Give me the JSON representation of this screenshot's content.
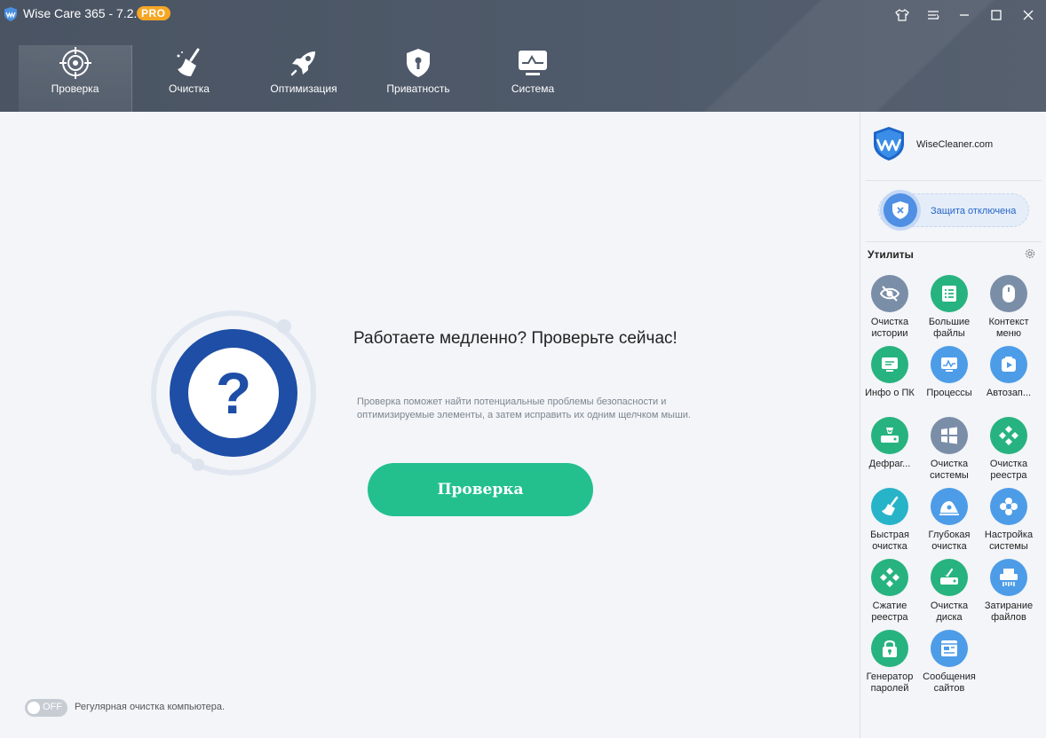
{
  "app": {
    "title": "Wise Care 365 - 7.2.5",
    "badge": "PRO"
  },
  "nav": [
    {
      "label": "Проверка",
      "icon": "crosshair-icon",
      "active": true
    },
    {
      "label": "Очистка",
      "icon": "broom-icon"
    },
    {
      "label": "Оптимизация",
      "icon": "rocket-icon"
    },
    {
      "label": "Приватность",
      "icon": "shield-lock-icon"
    },
    {
      "label": "Система",
      "icon": "monitor-icon"
    }
  ],
  "main": {
    "headline": "Работаете медленно? Проверьте сейчас!",
    "description": "Проверка поможет найти потенциальные проблемы безопасности и оптимизируемые элементы, а затем исправить их одним щелчком мыши.",
    "scan_button": "Проверка",
    "toggle_state": "OFF",
    "toggle_label": "Регулярная очистка компьютера."
  },
  "sidebar": {
    "brand": "WiseCleaner.com",
    "protection": "Защита отключена",
    "tools_title": "Утилиты",
    "tools": [
      {
        "label": "Очистка\nистории",
        "icon": "eye-off-icon",
        "color": "#7b8ea8"
      },
      {
        "label": "Большие\nфайлы",
        "icon": "file-list-icon",
        "color": "#27b37f"
      },
      {
        "label": "Контекст\nменю",
        "icon": "mouse-icon",
        "color": "#7b8ea8"
      },
      {
        "label": "Инфо о ПК",
        "icon": "pc-info-icon",
        "color": "#27b37f"
      },
      {
        "label": "Процессы",
        "icon": "process-monitor-icon",
        "color": "#4d9ce8"
      },
      {
        "label": "Автозап...",
        "icon": "play-icon",
        "color": "#4d9ce8"
      },
      {
        "label": "Дефраг...",
        "icon": "disk-defrag-icon",
        "color": "#27b37f"
      },
      {
        "label": "Очистка\nсистемы",
        "icon": "windows-icon",
        "color": "#7b8ea8"
      },
      {
        "label": "Очистка\nреестра",
        "icon": "registry-icon",
        "color": "#27b37f"
      },
      {
        "label": "Быстрая\nочистка",
        "icon": "broom-icon",
        "color": "#27b3c8"
      },
      {
        "label": "Глубокая\nочистка",
        "icon": "vacuum-icon",
        "color": "#4d9ce8"
      },
      {
        "label": "Настройка\nсистемы",
        "icon": "settings-flower-icon",
        "color": "#4d9ce8"
      },
      {
        "label": "Сжатие\nреестра",
        "icon": "registry-compress-icon",
        "color": "#27b37f"
      },
      {
        "label": "Очистка\nдиска",
        "icon": "disk-clean-icon",
        "color": "#27b37f"
      },
      {
        "label": "Затирание\nфайлов",
        "icon": "shredder-icon",
        "color": "#4d9ce8"
      },
      {
        "label": "Генератор\nпаролей",
        "icon": "password-lock-icon",
        "color": "#27b37f"
      },
      {
        "label": "Сообщения\nсайтов",
        "icon": "web-message-icon",
        "color": "#4d9ce8"
      }
    ]
  }
}
